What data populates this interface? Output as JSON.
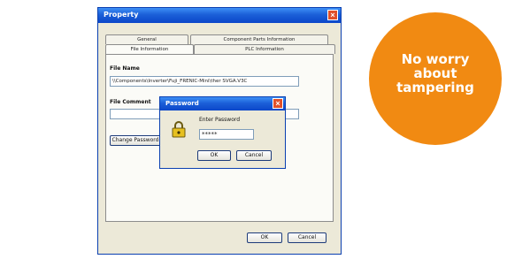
{
  "property_window": {
    "title": "Property",
    "tabs_row1": [
      "General",
      "Component Parts Information"
    ],
    "tabs_row2": [
      "File Information",
      "PLC Information"
    ],
    "file_name_label": "File Name",
    "file_name_value": "\\\\Components\\Inverter\\Fuji_FRENIC-Mini\\ther SVGA.V3C",
    "file_comment_label": "File Comment",
    "file_comment_value": "",
    "change_password_label": "Change Password",
    "ok_label": "OK",
    "cancel_label": "Cancel"
  },
  "password_dialog": {
    "title": "Password",
    "prompt": "Enter Password",
    "masked_value": "*****",
    "ok_label": "OK",
    "cancel_label": "Cancel"
  },
  "badge": {
    "lines": [
      "No worry",
      "about",
      "tampering"
    ],
    "color": "#f18a12"
  },
  "icons": {
    "window_close": "close-icon",
    "dialog_close": "close-icon",
    "password_lock": "lock-icon"
  }
}
